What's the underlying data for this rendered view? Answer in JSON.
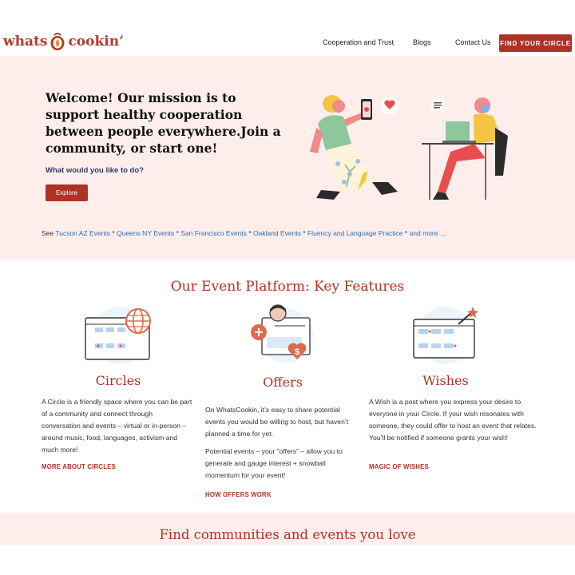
{
  "header": {
    "logo_left": "whats",
    "logo_right": "cookin’",
    "nav": [
      "Cooperation and Trust",
      "Blogs",
      "Contact Us"
    ],
    "cta": "FIND YOUR CIRCLE"
  },
  "hero": {
    "title": "Welcome! Our mission is to support healthy cooperation between people everywhere.Join a community, or start one!",
    "subtitle": "What would you like to do?",
    "explore": "Explore",
    "see_prefix": "See",
    "links": [
      "Tucson AZ Events",
      "Queens NY Events",
      "San Francisco Events",
      "Oakland Events",
      "Fluency and Language Practice",
      "and more …"
    ],
    "separator": " * "
  },
  "features": {
    "title": "Our Event Platform: Key Features",
    "circles": {
      "heading": "Circles",
      "body": "A Circle is a friendly space where you can be part of a community and connect through conversation and events – virtual or in-person – around music, food, languages, activism and much more!",
      "link": "MORE ABOUT CIRCLES"
    },
    "offers": {
      "heading": "Offers",
      "body1": "On WhatsCookin, it’s easy to share potential events you would be willing to host, but haven’t planned a time for yet.",
      "body2": "Potential events – your “offers” – allow you to generate and gauge interest + snowball momentum for your event!",
      "link": "HOW OFFERS WORK"
    },
    "wishes": {
      "heading": "Wishes",
      "body": "A Wish is a post where you express your desire to everyone in your Circle. If your wish resonates with someone, they could offer to host an event that relates.  You’ll be notified if someone grants your wish!",
      "link": "MAGIC OF WISHES"
    }
  },
  "bottom": {
    "title": "Find communities and events you love"
  },
  "colors": {
    "brand": "#ad3325",
    "hero_bg": "#fdeeec",
    "link": "#2b6cb0",
    "subtitle": "#2d3e63"
  }
}
